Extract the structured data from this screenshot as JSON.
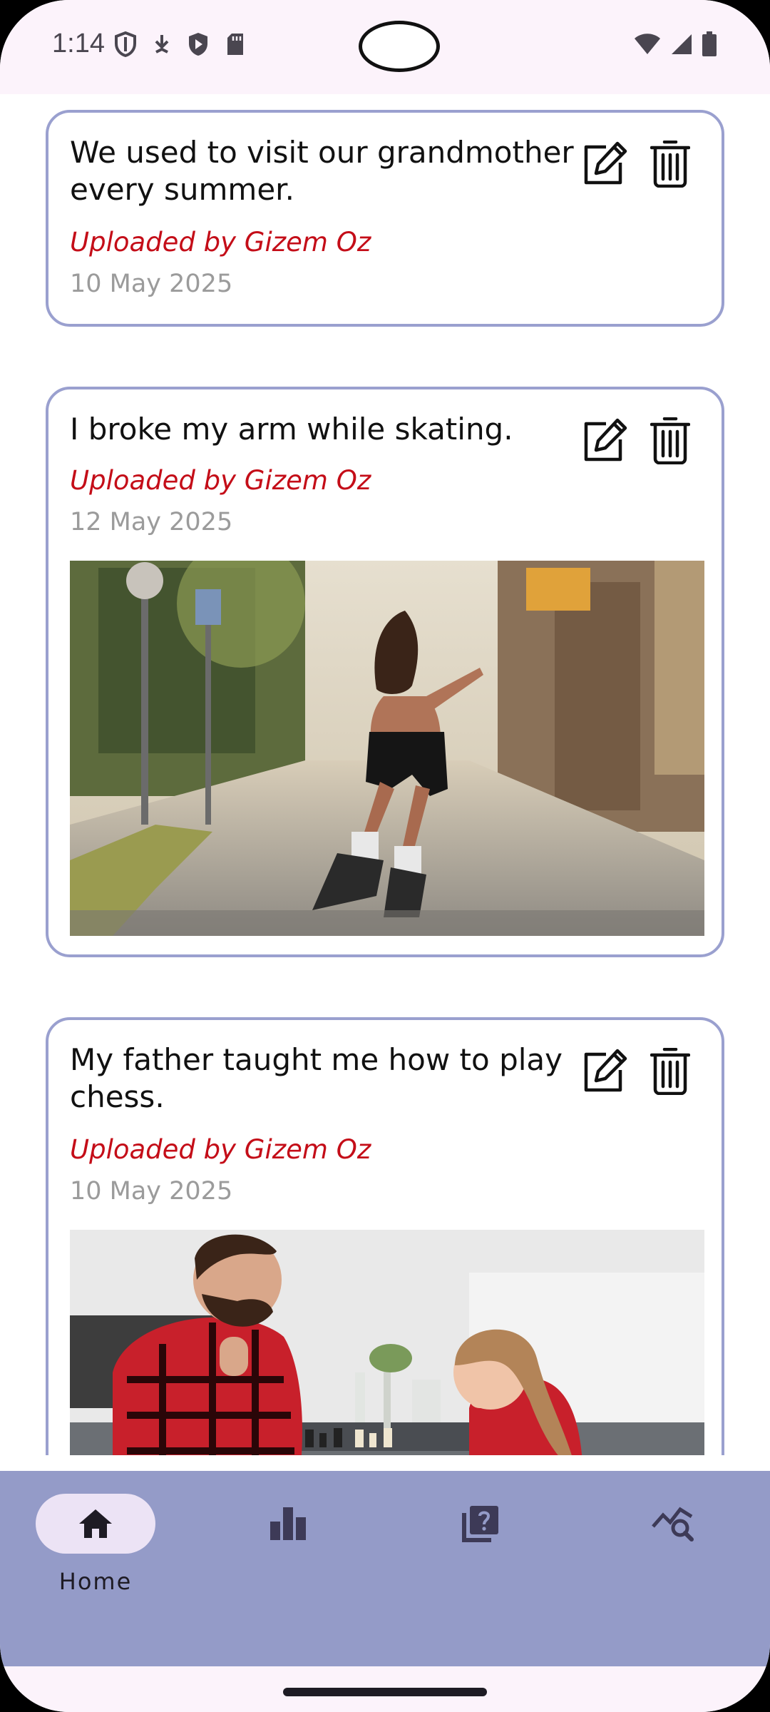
{
  "status_bar": {
    "time": "1:14",
    "left_icons": [
      "shield-icon",
      "download-icon",
      "play-protect-icon",
      "sd-card-icon"
    ],
    "right_icons": [
      "wifi-icon",
      "signal-icon",
      "battery-icon"
    ]
  },
  "memories": [
    {
      "title": "We used to visit our grandmother every summer.",
      "uploader": "Uploaded by Gizem Oz",
      "date": "10 May 2025",
      "has_image": false
    },
    {
      "title": "I broke my arm while skating.",
      "uploader": "Uploaded by Gizem Oz",
      "date": "12 May 2025",
      "has_image": true,
      "image_subject": "roller-skater-on-street"
    },
    {
      "title": "My father taught me how to play chess.",
      "uploader": "Uploaded by Gizem Oz",
      "date": "10 May 2025",
      "has_image": true,
      "image_subject": "father-and-daughter-playing-chess"
    }
  ],
  "bottom_nav": {
    "items": [
      {
        "label": "Home",
        "icon": "home-icon",
        "active": true
      },
      {
        "label": "",
        "icon": "bar-chart-icon",
        "active": false
      },
      {
        "label": "",
        "icon": "quiz-icon",
        "active": false
      },
      {
        "label": "",
        "icon": "query-stats-icon",
        "active": false
      }
    ]
  },
  "colors": {
    "card_border": "#9aa0cf",
    "uploader_text": "#c40d18",
    "nav_background": "#949bc8",
    "nav_active_pill": "#ece3f5",
    "status_bar_bg": "#fcf3fb"
  }
}
